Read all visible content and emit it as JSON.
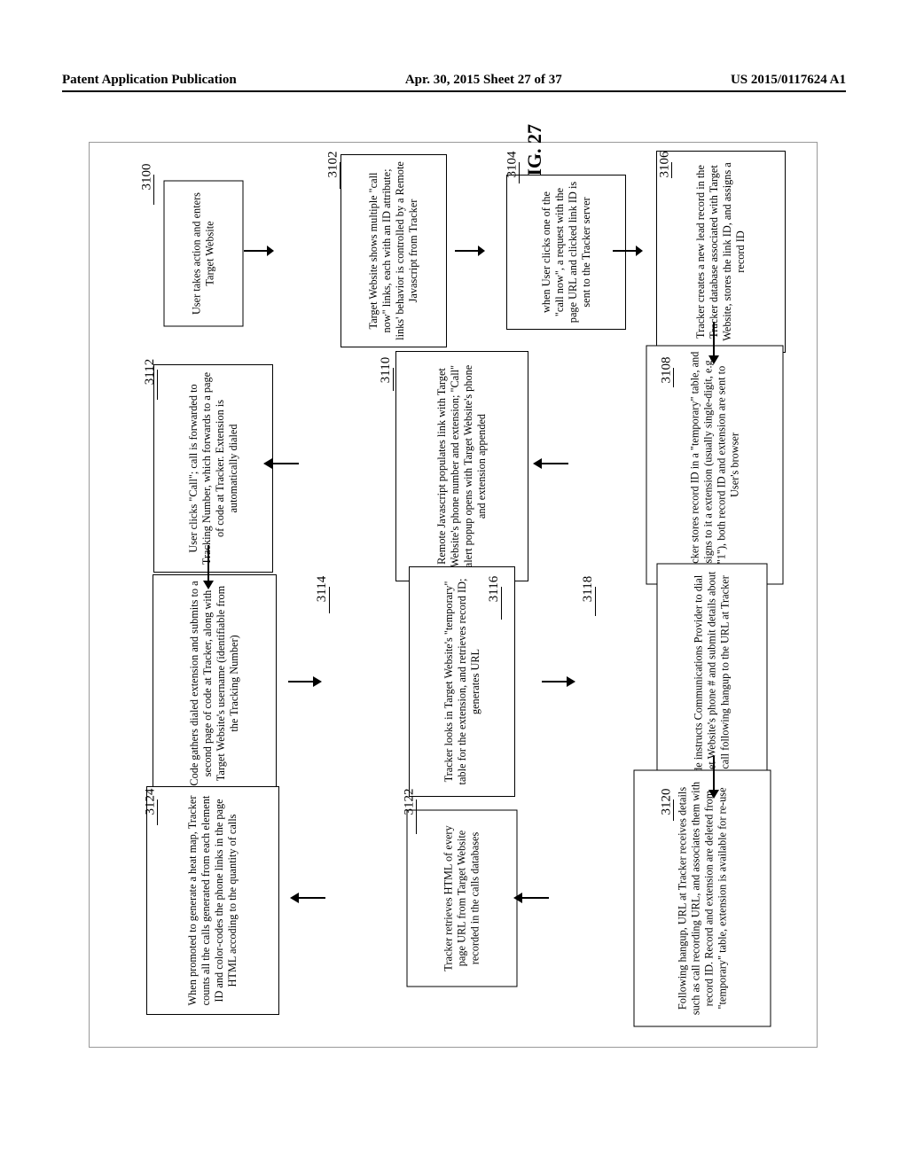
{
  "header": {
    "left": "Patent Application Publication",
    "center": "Apr. 30, 2015  Sheet 27 of 37",
    "right": "US 2015/0117624 A1"
  },
  "figure": {
    "label": "FIG. 27",
    "refs": {
      "r3100": "3100",
      "r3102": "3102",
      "r3104": "3104",
      "r3106": "3106",
      "r3108": "3108",
      "r3110": "3110",
      "r3112": "3112",
      "r3114": "3114",
      "r3116": "3116",
      "r3118": "3118",
      "r3120": "3120",
      "r3122": "3122",
      "r3124": "3124"
    },
    "boxes": {
      "b3100": "User takes action and enters Target Website",
      "b3102": "Target Website shows multiple \"call now\" links, each with an ID attribute; links' behavior is controlled by a Remote Javascript from Tracker",
      "b3104": "when User clicks one of the \"call now\", a request with the page URL and clicked link ID is sent to the Tracker server",
      "b3106": "Tracker creates a new lead record in the Tracker database associated with Target Website, stores the link ID, and assigns a record ID",
      "b3108": "Tracker stores record ID in a \"temporary\" table, and assigns to it a extension (usually single-digit, e.g. \"1\"), both record ID and extension are sent to User's browser",
      "b3110": "Remote Javascript populates link with Target Website's phone number and extension; \"Call\" alert popup opens with Target Website's phone and extension appended",
      "b3112": "User clicks \"Call\"; call is forwarded to Tracking Number, which forwards to a page of code at Tracker. Extension is automatically dialed",
      "b3114": "Code gathers dialed extension and submits to a second page of code at Tracker, along with Target Website's username (identifiable from the Tracking Number)",
      "b3116": "Tracker looks in Target Website's \"temporary\" table for the extension, and retrieves record ID; generates URL",
      "b3118": "Code instructs Communications Provider to dial Target Website's phone # and submit details about the call following hangup to the URL at Tracker",
      "b3120": "Following hangup, URL at Tracker receives details such as call recording URL, and associates them with record ID. Record and extension are deleted from \"temporary\" table, extension is available for re-use",
      "b3122": "Tracker retrieves HTML of every page URL from Target Website recorded in the calls databases",
      "b3124": "When promoted to generate a heat map, Tracker counts all the calls generated from each element ID and color-codes the phone links in the page HTML accoding to the quantity of calls"
    }
  }
}
